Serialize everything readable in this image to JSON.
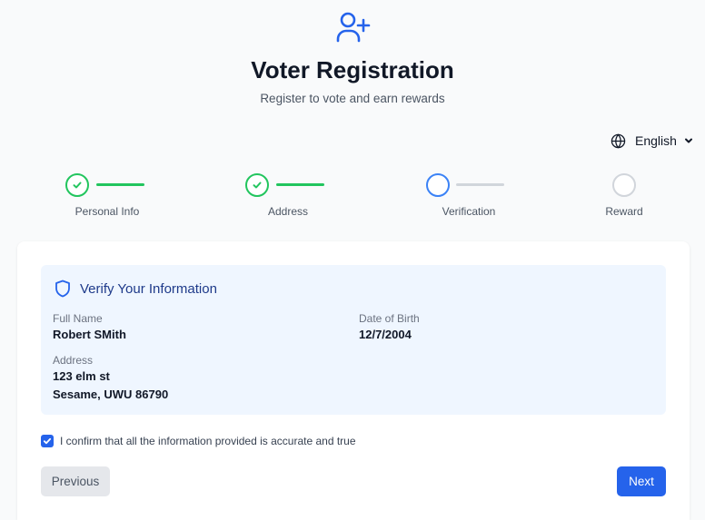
{
  "header": {
    "icon": "user-plus-icon",
    "title": "Voter Registration",
    "subtitle": "Register to vote and earn rewards"
  },
  "language": {
    "icon": "globe-icon",
    "selected": "English"
  },
  "stepper": {
    "steps": [
      {
        "label": "Personal Info",
        "status": "complete"
      },
      {
        "label": "Address",
        "status": "complete"
      },
      {
        "label": "Verification",
        "status": "current"
      },
      {
        "label": "Reward",
        "status": "upcoming"
      }
    ]
  },
  "verify": {
    "icon": "shield-icon",
    "title": "Verify Your Information",
    "full_name_label": "Full Name",
    "full_name": "Robert SMith",
    "dob_label": "Date of Birth",
    "dob": "12/7/2004",
    "address_label": "Address",
    "address_line1": "123 elm st",
    "address_line2": "Sesame, UWU 86790"
  },
  "confirm": {
    "checked": true,
    "label": "I confirm that all the information provided is accurate and true"
  },
  "buttons": {
    "previous": "Previous",
    "next": "Next"
  },
  "colors": {
    "primary": "#2563eb",
    "success": "#22c55e",
    "current": "#3b82f6",
    "inactive": "#d1d5db",
    "info_bg": "#eff6ff"
  }
}
